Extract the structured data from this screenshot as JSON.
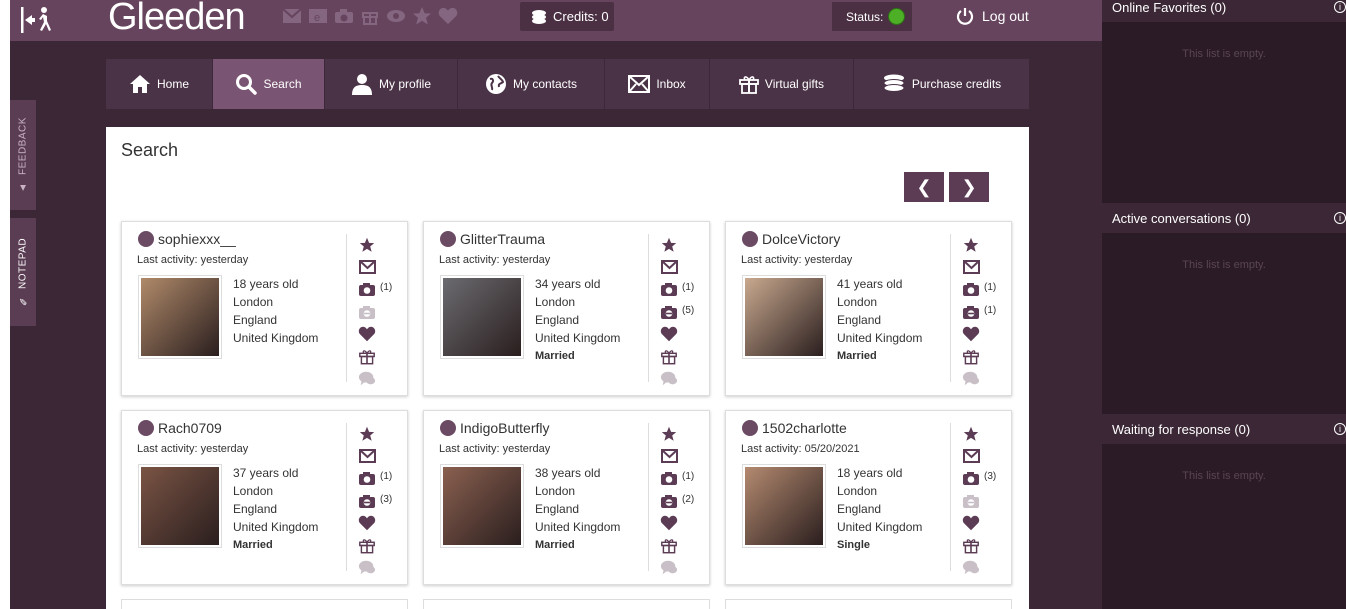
{
  "header": {
    "logo": "Gleeden",
    "credits_label": "Credits: 0",
    "status_label": "Status:",
    "logout_label": "Log out"
  },
  "sidebar_tabs": {
    "feedback": "FEEDBACK",
    "notepad": "NOTEPAD"
  },
  "nav": [
    {
      "label": "Home",
      "icon": "home-icon"
    },
    {
      "label": "Search",
      "icon": "search-icon"
    },
    {
      "label": "My profile",
      "icon": "user-icon"
    },
    {
      "label": "My contacts",
      "icon": "globe-icon"
    },
    {
      "label": "Inbox",
      "icon": "envelope-icon"
    },
    {
      "label": "Virtual gifts",
      "icon": "gift-icon"
    },
    {
      "label": "Purchase credits",
      "icon": "coins-icon"
    }
  ],
  "main": {
    "title": "Search"
  },
  "profiles": [
    {
      "username": "sophiexxx__",
      "last_activity": "Last activity: yesterday",
      "age": "18 years old",
      "city": "London",
      "region": "England",
      "country": "United Kingdom",
      "marital": "",
      "photos": "(1)",
      "private_photos": "",
      "photo_color": "#b08a6a"
    },
    {
      "username": "GlitterTrauma",
      "last_activity": "Last activity: yesterday",
      "age": "34 years old",
      "city": "London",
      "region": "England",
      "country": "United Kingdom",
      "marital": "Married",
      "photos": "(1)",
      "private_photos": "(5)",
      "photo_color": "#6b6b70"
    },
    {
      "username": "DolceVictory",
      "last_activity": "Last activity: yesterday",
      "age": "41 years old",
      "city": "London",
      "region": "England",
      "country": "United Kingdom",
      "marital": "Married",
      "photos": "(1)",
      "private_photos": "(1)",
      "photo_color": "#c9a98f"
    },
    {
      "username": "Rach0709",
      "last_activity": "Last activity: yesterday",
      "age": "37 years old",
      "city": "London",
      "region": "England",
      "country": "United Kingdom",
      "marital": "Married",
      "photos": "(1)",
      "private_photos": "(3)",
      "photo_color": "#7a5444"
    },
    {
      "username": "IndigoButterfly",
      "last_activity": "Last activity: yesterday",
      "age": "38 years old",
      "city": "London",
      "region": "England",
      "country": "United Kingdom",
      "marital": "Married",
      "photos": "(1)",
      "private_photos": "(2)",
      "photo_color": "#8a6050"
    },
    {
      "username": "1502charlotte",
      "last_activity": "Last activity: 05/20/2021",
      "age": "18 years old",
      "city": "London",
      "region": "England",
      "country": "United Kingdom",
      "marital": "Single",
      "photos": "(3)",
      "private_photos": "",
      "photo_color": "#b48a70"
    }
  ],
  "right_panel": {
    "online_favorites": "Online Favorites (0)",
    "active_conversations": "Active conversations (0)",
    "waiting_for_response": "Waiting for response (0)",
    "empty_text": "This list is empty."
  },
  "colors": {
    "brand": "#66445e",
    "nav_bg": "#4b3347",
    "nav_active": "#7a5573",
    "icon": "#5c3b55",
    "status_online": "#4caf26"
  }
}
